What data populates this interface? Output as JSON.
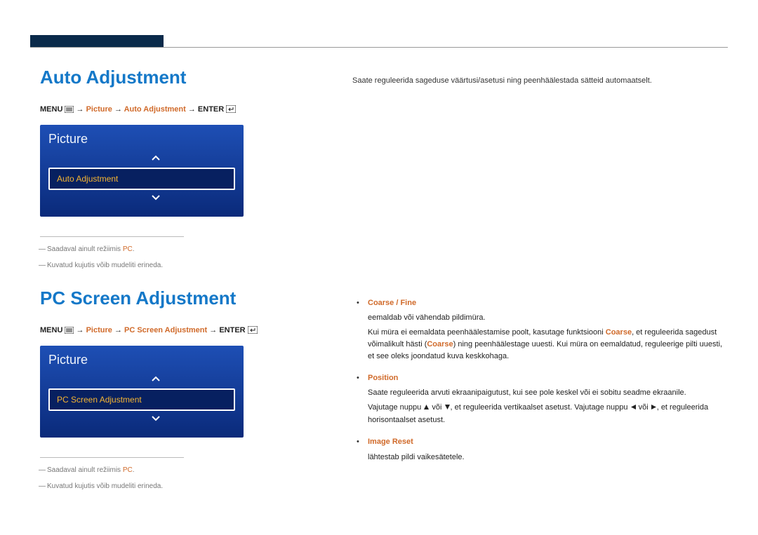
{
  "section1": {
    "title": "Auto Adjustment",
    "nav_prefix": "MENU",
    "nav_arrow": "→",
    "nav_part1": "Picture",
    "nav_part2": "Auto Adjustment",
    "nav_suffix": "ENTER",
    "menu_title": "Picture",
    "menu_item": "Auto Adjustment",
    "note1_prefix": "Saadaval ainult režiimis ",
    "note1_pc": "PC",
    "note1_suffix": ".",
    "note2": "Kuvatud kujutis võib mudeliti erineda."
  },
  "section2": {
    "title": "PC Screen Adjustment",
    "nav_prefix": "MENU",
    "nav_arrow": "→",
    "nav_part1": "Picture",
    "nav_part2": "PC Screen Adjustment",
    "nav_suffix": "ENTER",
    "menu_title": "Picture",
    "menu_item": "PC Screen Adjustment",
    "note1_prefix": "Saadaval ainult režiimis ",
    "note1_pc": "PC",
    "note1_suffix": ".",
    "note2": "Kuvatud kujutis võib mudeliti erineda."
  },
  "right": {
    "intro": "Saate reguleerida sageduse väärtusi/asetusi ning peenhäälestada sätteid automaatselt.",
    "bullets": {
      "b1": {
        "title": "Coarse / Fine",
        "line1": "eemaldab või vähendab pildimüra.",
        "line2a": "Kui müra ei eemaldata peenhäälestamise poolt, kasutage funktsiooni ",
        "line2b": "Coarse",
        "line2c": ", et reguleerida sagedust võimalikult hästi (",
        "line2d": "Coarse",
        "line2e": ") ning peenhäälestage uuesti. Kui müra on eemaldatud, reguleerige pilti uuesti, et see oleks joondatud kuva keskkohaga."
      },
      "b2": {
        "title": "Position",
        "line1": "Saate reguleerida arvuti ekraanipaigutust, kui see pole keskel või ei sobitu seadme ekraanile.",
        "line2a": "Vajutage nuppu ",
        "line2b": " või ",
        "line2c": ", et reguleerida vertikaalset asetust. Vajutage nuppu ",
        "line2d": " või ",
        "line2e": ", et reguleerida horisontaalset asetust."
      },
      "b3": {
        "title": "Image Reset",
        "line1": "lähtestab pildi vaikesätetele."
      }
    }
  }
}
